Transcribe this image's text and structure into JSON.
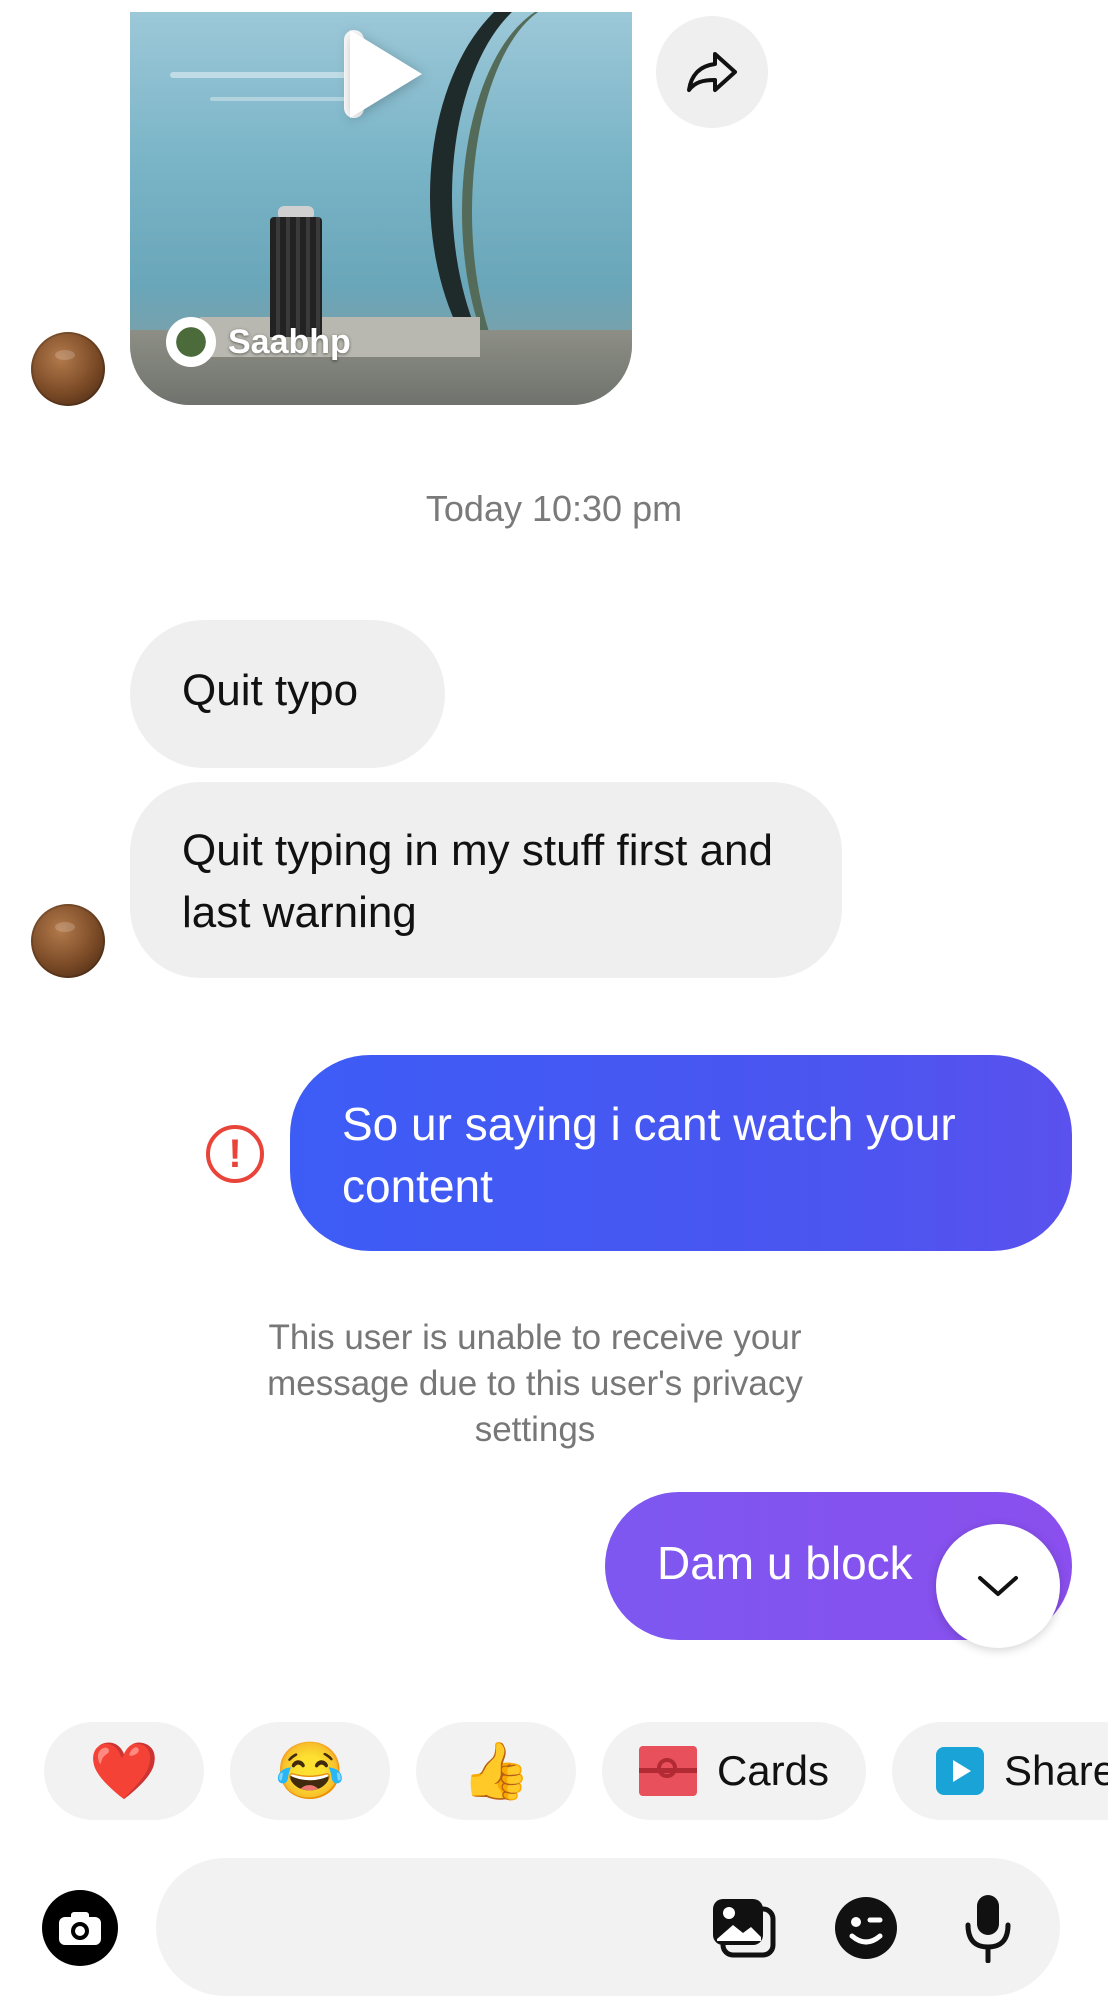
{
  "thread": {
    "video_message": {
      "username": "Saabhp"
    },
    "timestamp": "Today 10:30 pm",
    "messages_in": [
      {
        "text": "Quit typo"
      },
      {
        "text": "Quit typing in my stuff first and last warning"
      }
    ],
    "messages_out": [
      {
        "text": "So ur saying i cant watch your content",
        "status": "failed"
      },
      {
        "text": "Dam u block"
      }
    ],
    "failure_notice": "This user is unable to receive your message due to this user's privacy settings"
  },
  "quick_replies": [
    {
      "kind": "emoji",
      "icon": "heart",
      "glyph": "❤️"
    },
    {
      "kind": "emoji",
      "icon": "laughing-tears",
      "glyph": "😂"
    },
    {
      "kind": "emoji",
      "icon": "thumbs-up",
      "glyph": "👍"
    },
    {
      "kind": "action",
      "icon": "cards-icon",
      "label": "Cards"
    },
    {
      "kind": "action",
      "icon": "share-icon",
      "label": "Share"
    }
  ],
  "composer": {
    "icons": [
      "camera-icon",
      "gallery-icon",
      "sticker-icon",
      "microphone-icon"
    ]
  },
  "colors": {
    "outgoing_primary": "#3d5cf6",
    "outgoing_secondary": "#8a4fee",
    "incoming_bubble": "#efefef",
    "error": "#e8443a"
  }
}
